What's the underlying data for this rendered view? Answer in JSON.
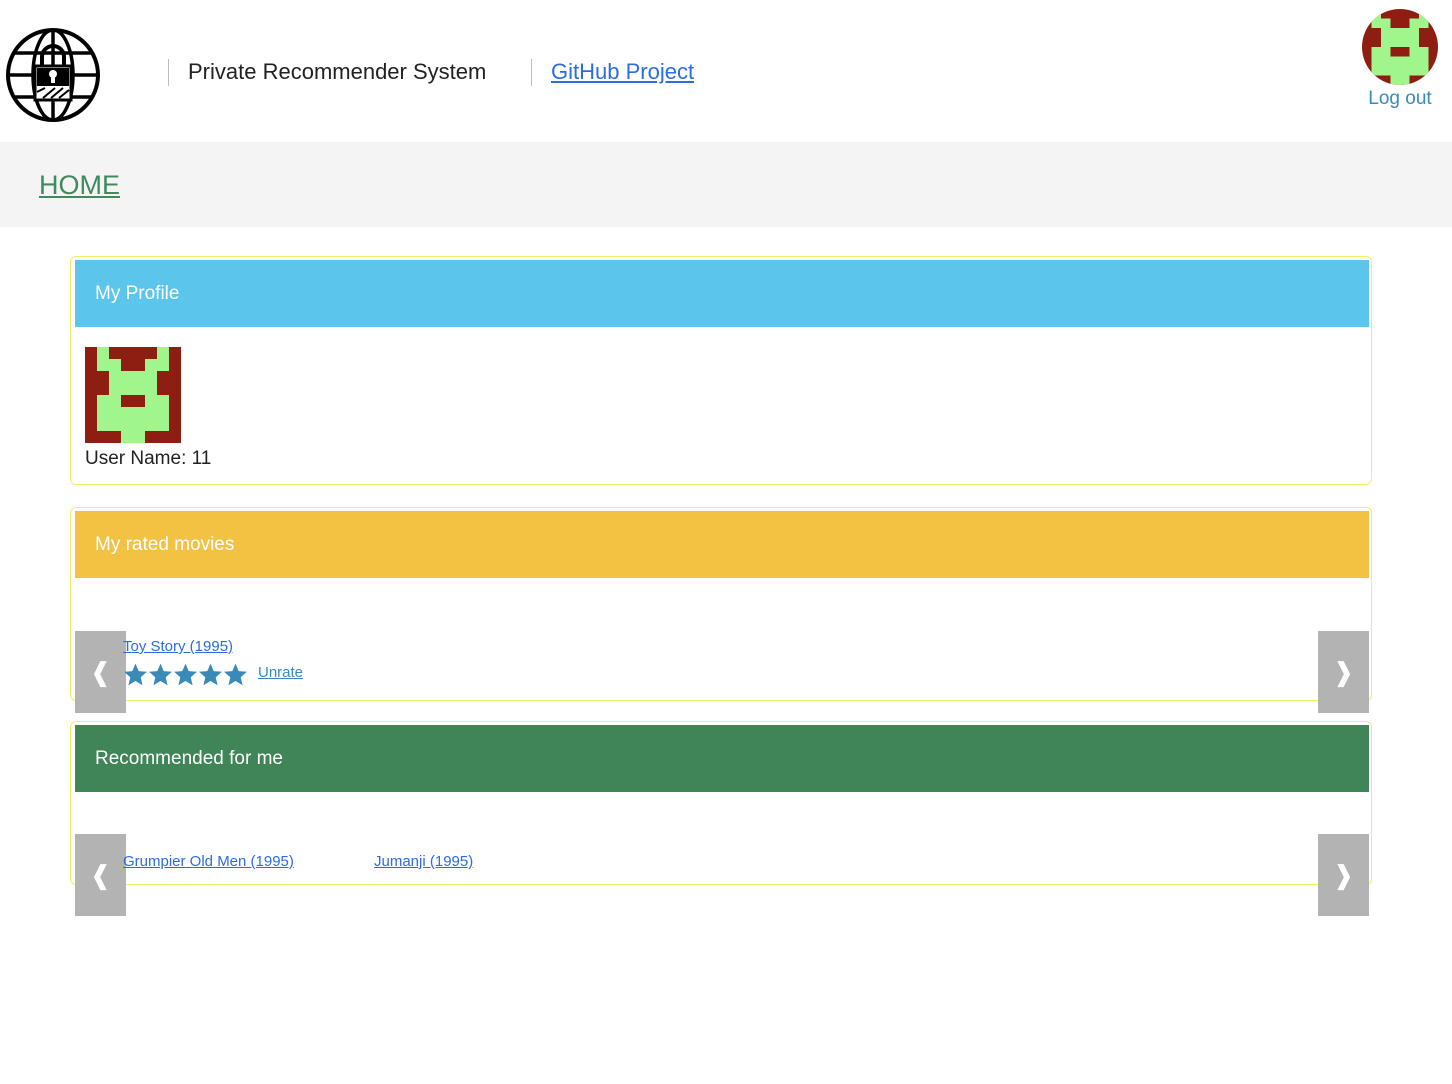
{
  "header": {
    "brand_title": "Private Recommender System",
    "github_label": "GitHub Project",
    "logout_label": "Log out",
    "logo_icon": "globe-lock-icon",
    "avatar_icon": "identicon-avatar"
  },
  "nav": {
    "home_label": "HOME"
  },
  "profile": {
    "title": "My Profile",
    "username_text": "User Name: 11"
  },
  "rated": {
    "title": "My rated movies",
    "items": [
      {
        "title": "Toy Story (1995)",
        "rating": 5,
        "max_rating": 5,
        "unrate_label": "Unrate"
      }
    ]
  },
  "recommended": {
    "title": "Recommended for me",
    "items": [
      {
        "title": "Grumpier Old Men (1995)"
      },
      {
        "title": "Jumanji (1995)"
      }
    ]
  },
  "colors": {
    "profile_header": "#5bc5eb",
    "rated_header": "#f3c242",
    "recommended_header": "#408558",
    "link": "#2b6de0",
    "star": "#3a8ab8",
    "identicon_bg": "#8e1d12",
    "identicon_fg": "#a0f68c"
  }
}
